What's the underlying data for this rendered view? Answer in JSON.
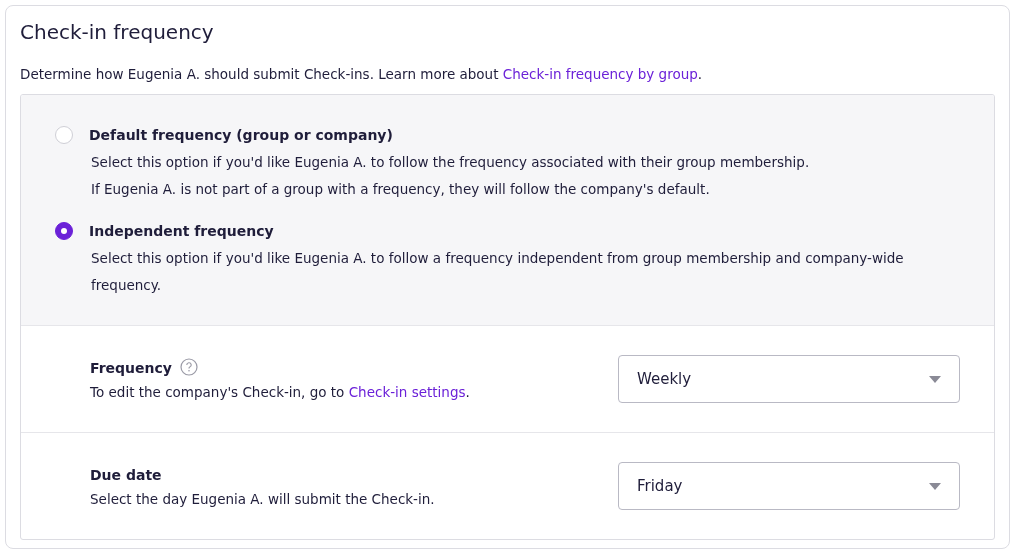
{
  "title": "Check-in frequency",
  "description": {
    "text": "Determine how Eugenia A. should submit Check-ins. Learn more about ",
    "link": "Check-in frequency by group",
    "suffix": "."
  },
  "options": [
    {
      "label": "Default frequency (group or company)",
      "selected": false,
      "lines": [
        "Select this option if you'd like Eugenia A. to follow the frequency associated with their group membership.",
        "If Eugenia A. is not part of a group with a frequency, they will follow the company's default."
      ]
    },
    {
      "label": "Independent frequency",
      "selected": true,
      "lines": [
        "Select this option if you'd like Eugenia A. to follow a frequency independent from group membership and company-wide frequency."
      ]
    }
  ],
  "settings": [
    {
      "label": "Frequency",
      "help": true,
      "text": "To edit the company's Check-in, go to ",
      "link": "Check-in settings",
      "suffix": ".",
      "value": "Weekly"
    },
    {
      "label": "Due date",
      "help": false,
      "text": "Select the day Eugenia A. will submit the Check-in.",
      "value": "Friday"
    }
  ]
}
